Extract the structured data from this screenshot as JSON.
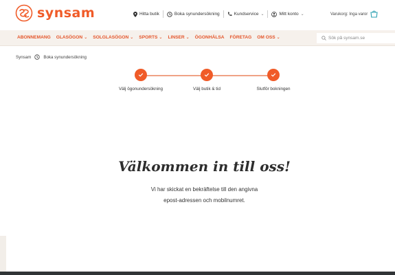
{
  "brand": {
    "name": "synsam",
    "accent": "#f05b28"
  },
  "topbar": {
    "links": [
      {
        "label": "Hitta butik",
        "icon": "location-pin-icon",
        "has_chevron": false
      },
      {
        "label": "Boka synundersökning",
        "icon": "clock-icon",
        "has_chevron": false
      },
      {
        "label": "Kundservice",
        "icon": "phone-icon",
        "has_chevron": true
      },
      {
        "label": "Mitt konto",
        "icon": "user-icon",
        "has_chevron": true
      }
    ],
    "cart_label": "Varukorg: Inga varor"
  },
  "nav": {
    "items": [
      {
        "label": "ABONNEMANG",
        "has_chevron": false
      },
      {
        "label": "GLASÖGON",
        "has_chevron": true
      },
      {
        "label": "SOLGLASÖGON",
        "has_chevron": true
      },
      {
        "label": "SPORTS",
        "has_chevron": true
      },
      {
        "label": "LINSER",
        "has_chevron": true
      },
      {
        "label": "ÖGONHÄLSA",
        "has_chevron": false
      },
      {
        "label": "FÖRETAG",
        "has_chevron": false
      },
      {
        "label": "OM OSS",
        "has_chevron": true
      }
    ],
    "search_placeholder": "Sök på synsam.se"
  },
  "breadcrumb": {
    "home": "Synsam",
    "current": "Boka synundersökning"
  },
  "stepper": {
    "steps": [
      {
        "label": "Välj ögonundersökning",
        "done": true
      },
      {
        "label": "Välj butik & tid",
        "done": true
      },
      {
        "label": "Slutför bokningen",
        "done": true
      }
    ]
  },
  "welcome": {
    "title": "Välkommen in till oss!",
    "line1": "Vi har skickat en bekräftelse till den angivna",
    "line2": "epost-adressen och mobilnumret."
  }
}
